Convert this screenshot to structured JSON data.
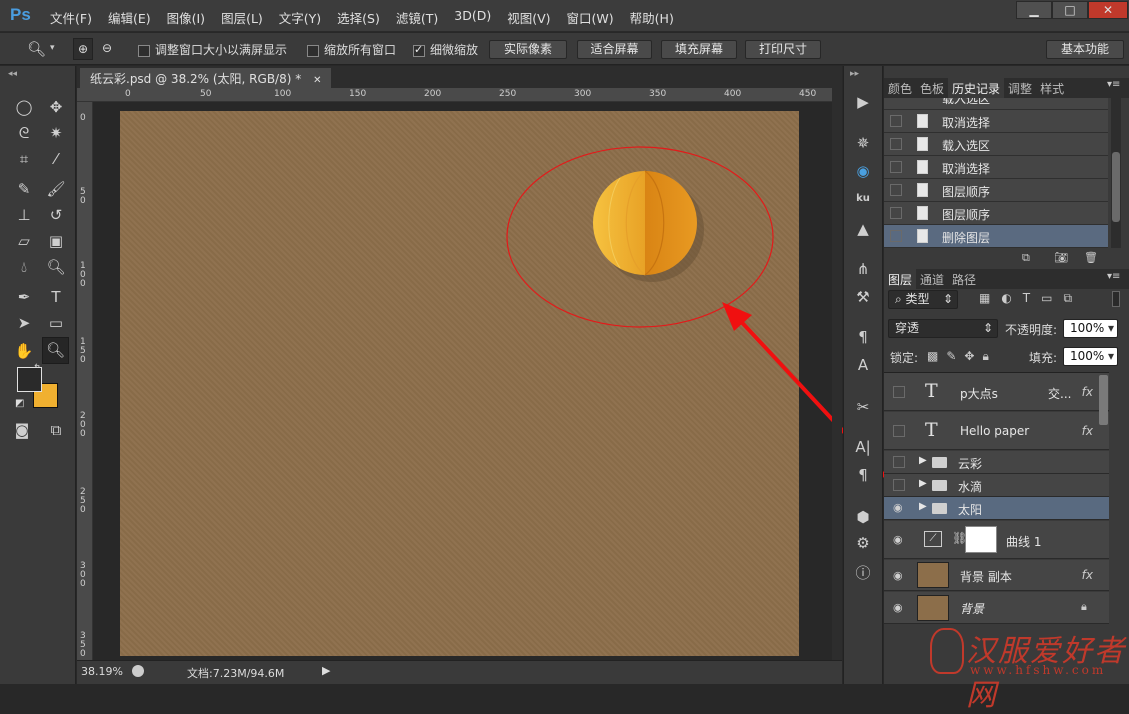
{
  "app": {
    "logo": "Ps"
  },
  "menu": [
    "文件(F)",
    "编辑(E)",
    "图像(I)",
    "图层(L)",
    "文字(Y)",
    "选择(S)",
    "滤镜(T)",
    "3D(D)",
    "视图(V)",
    "窗口(W)",
    "帮助(H)"
  ],
  "window_controls": {
    "minimize": "▁",
    "maximize": "□",
    "close": "✕"
  },
  "options": {
    "resize_windows": "调整窗口大小以满屏显示",
    "zoom_all": "缩放所有窗口",
    "scrubby_zoom": "细微缩放",
    "actual_pixels": "实际像素",
    "fit_screen": "适合屏幕",
    "fill_screen": "填充屏幕",
    "print_size": "打印尺寸",
    "workspace": "基本功能"
  },
  "document": {
    "tab_title": "纸云彩.psd @ 38.2% (太阳, RGB/8) *",
    "ruler_top": [
      "0",
      "50",
      "100",
      "150",
      "200",
      "250",
      "300",
      "350",
      "400",
      "450"
    ],
    "ruler_left": [
      "0",
      "5 0",
      "1 0 0",
      "1 5 0",
      "2 0 0",
      "2 5 0",
      "3 0 0",
      "3 5 0"
    ],
    "zoom": "38.19%",
    "doc_size": "文档:7.23M/94.6M",
    "canvas_color": "#8c6e4a"
  },
  "history_panel": {
    "tabs": [
      "颜色",
      "色板",
      "历史记录",
      "调整",
      "样式"
    ],
    "active_tab": "历史记录",
    "items": [
      {
        "label": "载入选区"
      },
      {
        "label": "取消选择"
      },
      {
        "label": "载入选区"
      },
      {
        "label": "取消选择"
      },
      {
        "label": "图层顺序"
      },
      {
        "label": "图层顺序"
      },
      {
        "label": "删除图层"
      }
    ]
  },
  "layers_panel": {
    "tabs": [
      "图层",
      "通道",
      "路径"
    ],
    "filter_kind": "类型",
    "blend_mode": "穿透",
    "opacity_label": "不透明度:",
    "opacity": "100%",
    "lock_label": "锁定:",
    "fill_label": "填充:",
    "fill": "100%",
    "layers": [
      {
        "name": "p大点s",
        "extra": "交...",
        "kind": "text",
        "visible": false,
        "fx": "fx"
      },
      {
        "name": "Hello paper",
        "kind": "text",
        "visible": false,
        "fx": "fx"
      },
      {
        "name": "云彩",
        "kind": "group",
        "visible": false
      },
      {
        "name": "水滴",
        "kind": "group",
        "visible": false
      },
      {
        "name": "太阳",
        "kind": "group",
        "visible": true,
        "selected": true
      },
      {
        "name": "曲线 1",
        "kind": "adjustment",
        "visible": true
      },
      {
        "name": "背景 副本",
        "kind": "image",
        "visible": true,
        "fx": "fx"
      },
      {
        "name": "背景",
        "kind": "image",
        "visible": true,
        "locked": true
      }
    ]
  },
  "watermark": {
    "title": "汉服爱好者网",
    "url": "www.hfshw.com"
  }
}
